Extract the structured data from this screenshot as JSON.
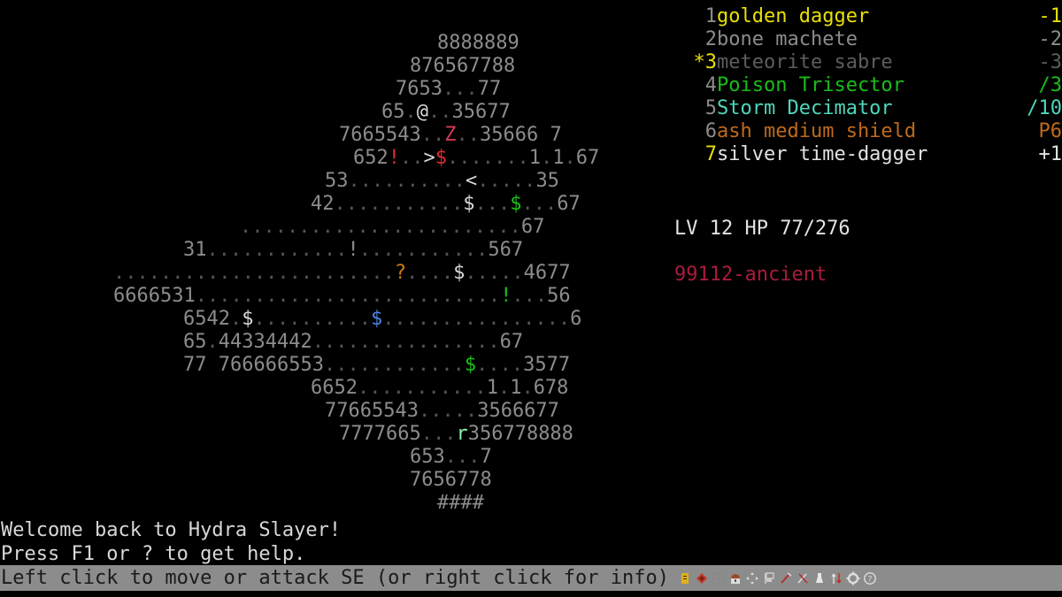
{
  "app": {
    "title": "Hydra Slayer",
    "background": "#000000"
  },
  "colors": {
    "wall": "#8c8c8c",
    "floor": "#555555",
    "player": "#d8d8d8",
    "enemy_z": "#d33a54",
    "gold": "#e8e005",
    "green": "#17c217",
    "blue": "#4d84e8",
    "orange": "#d07a16",
    "red": "#e02d2d",
    "hintbar_bg": "#8c8c8c",
    "seed": "#a81c3c"
  },
  "map": {
    "legend": {
      "@": "player",
      "Z": "hydra-enemy",
      "r": "rat-enemy",
      "$": "treasure",
      "!": "potion",
      "?": "scroll",
      ">": "stairs-down",
      "<": "stairs-up",
      "#": "wall-block",
      ".": "floor",
      "digits": "wall-thickness"
    },
    "rows": [
      {
        "indent": 31,
        "cells": [
          [
            "8888889",
            "wall"
          ]
        ]
      },
      {
        "indent": 29,
        "cells": [
          [
            "876567788",
            "wall"
          ]
        ]
      },
      {
        "indent": 28,
        "cells": [
          [
            "7653",
            "wall"
          ],
          [
            "...",
            "floor"
          ],
          [
            "77",
            "wall"
          ]
        ]
      },
      {
        "indent": 27,
        "cells": [
          [
            "65",
            "wall"
          ],
          [
            ".",
            "floor"
          ],
          [
            "@",
            "white"
          ],
          [
            "..",
            "floor"
          ],
          [
            "35677",
            "wall"
          ]
        ]
      },
      {
        "indent": 24,
        "cells": [
          [
            "7665543",
            "wall"
          ],
          [
            "..",
            "floor"
          ],
          [
            "Z",
            "crimson"
          ],
          [
            "..",
            "floor"
          ],
          [
            "35666 7",
            "wall"
          ]
        ]
      },
      {
        "indent": 25,
        "cells": [
          [
            "652",
            "wall"
          ],
          [
            "!",
            "red"
          ],
          [
            "..",
            "floor"
          ],
          [
            ">",
            "white"
          ],
          [
            "$",
            "red"
          ],
          [
            ".......",
            "floor"
          ],
          [
            "1",
            "wall"
          ],
          [
            ".",
            "floor"
          ],
          [
            "1",
            "wall"
          ],
          [
            ".",
            "floor"
          ],
          [
            "67",
            "wall"
          ]
        ]
      },
      {
        "indent": 23,
        "cells": [
          [
            "53",
            "wall"
          ],
          [
            "..........",
            "floor"
          ],
          [
            "<",
            "white"
          ],
          [
            ".....",
            "floor"
          ],
          [
            "35",
            "wall"
          ]
        ]
      },
      {
        "indent": 22,
        "cells": [
          [
            "42",
            "wall"
          ],
          [
            "...........",
            "floor"
          ],
          [
            "$",
            "white"
          ],
          [
            "...",
            "floor"
          ],
          [
            "$",
            "green"
          ],
          [
            "...",
            "floor"
          ],
          [
            "67",
            "wall"
          ]
        ]
      },
      {
        "indent": 17,
        "cells": [
          [
            "........................",
            "floor"
          ],
          [
            "67",
            "wall"
          ]
        ]
      },
      {
        "indent": 13,
        "cells": [
          [
            "31",
            "wall"
          ],
          [
            "............",
            "floor"
          ],
          [
            "!",
            "grey"
          ],
          [
            "...........",
            "floor"
          ],
          [
            "567",
            "wall"
          ]
        ]
      },
      {
        "indent": 8,
        "cells": [
          [
            "........................",
            "floor"
          ],
          [
            "?",
            "orange"
          ],
          [
            "....",
            "floor"
          ],
          [
            "$",
            "white"
          ],
          [
            ".....",
            "floor"
          ],
          [
            "4677",
            "wall"
          ]
        ]
      },
      {
        "indent": 8,
        "cells": [
          [
            "6666531",
            "wall"
          ],
          [
            "..........................",
            "floor"
          ],
          [
            "!",
            "green"
          ],
          [
            "...",
            "floor"
          ],
          [
            "56",
            "wall"
          ]
        ]
      },
      {
        "indent": 13,
        "cells": [
          [
            "6542",
            "wall"
          ],
          [
            ".",
            "floor"
          ],
          [
            "$",
            "white"
          ],
          [
            "..........",
            "floor"
          ],
          [
            "$",
            "blue"
          ],
          [
            "................",
            "floor"
          ],
          [
            "6",
            "wall"
          ]
        ]
      },
      {
        "indent": 13,
        "cells": [
          [
            "65",
            "wall"
          ],
          [
            ".",
            "floor"
          ],
          [
            "44334442",
            "wall"
          ],
          [
            "................",
            "floor"
          ],
          [
            "67",
            "wall"
          ]
        ]
      },
      {
        "indent": 13,
        "cells": [
          [
            "77 766666553",
            "wall"
          ],
          [
            "............",
            "floor"
          ],
          [
            "$",
            "green"
          ],
          [
            "....",
            "floor"
          ],
          [
            "3577",
            "wall"
          ]
        ]
      },
      {
        "indent": 22,
        "cells": [
          [
            "6652",
            "wall"
          ],
          [
            "...........",
            "floor"
          ],
          [
            "1",
            "wall"
          ],
          [
            ".",
            "floor"
          ],
          [
            "1",
            "wall"
          ],
          [
            ".",
            "floor"
          ],
          [
            "678",
            "wall"
          ]
        ]
      },
      {
        "indent": 23,
        "cells": [
          [
            "77665543",
            "wall"
          ],
          [
            ".....",
            "floor"
          ],
          [
            "3566677",
            "wall"
          ]
        ]
      },
      {
        "indent": 24,
        "cells": [
          [
            "7777665",
            "wall"
          ],
          [
            "...",
            "floor"
          ],
          [
            "r",
            "ltgreen"
          ],
          [
            "356778888",
            "wall"
          ]
        ]
      },
      {
        "indent": 29,
        "cells": [
          [
            "653",
            "wall"
          ],
          [
            "...",
            "floor"
          ],
          [
            "7",
            "wall"
          ]
        ]
      },
      {
        "indent": 29,
        "cells": [
          [
            "7656778",
            "wall"
          ]
        ]
      },
      {
        "indent": 31,
        "cells": [
          [
            "####",
            "wall"
          ]
        ]
      }
    ]
  },
  "inventory": {
    "items": [
      {
        "index": "1",
        "selected": false,
        "name": "golden dagger",
        "value": "-1",
        "color": "yellow",
        "index_color": "grey"
      },
      {
        "index": "2",
        "selected": false,
        "name": "bone machete",
        "value": "-2",
        "color": "grey",
        "index_color": "grey"
      },
      {
        "index": "3",
        "selected": true,
        "name": "meteorite sabre",
        "value": "-3",
        "color": "dim",
        "index_color": "yellow"
      },
      {
        "index": "4",
        "selected": false,
        "name": "Poison Trisector",
        "value": "/3",
        "color": "green",
        "index_color": "grey"
      },
      {
        "index": "5",
        "selected": false,
        "name": "Storm Decimator",
        "value": "/10",
        "color": "teal",
        "index_color": "grey"
      },
      {
        "index": "6",
        "selected": false,
        "name": "ash medium shield",
        "value": "P6",
        "color": "brown",
        "index_color": "grey"
      },
      {
        "index": "7",
        "selected": false,
        "name": "silver time-dagger",
        "value": "+1",
        "color": "white",
        "index_color": "yellow"
      }
    ],
    "selection_marker": "*"
  },
  "stats": {
    "line": "LV 12 HP 77/276",
    "level_label": "LV",
    "level": "12",
    "hp_label": "HP",
    "hp_current": "77",
    "hp_max": "276"
  },
  "seed": {
    "text": "99112-ancient"
  },
  "messages": [
    "Welcome back to Hydra Slayer!",
    "Press F1 or ? to get help."
  ],
  "hintbar": {
    "text": "Left click to move or attack SE (or right click for info)",
    "icons": [
      {
        "name": "scroll-icon",
        "color": "#e0b21a"
      },
      {
        "name": "gem-icon",
        "color": "#c0392b"
      },
      {
        "name": "grid-map-icon",
        "color": "#888888"
      },
      {
        "name": "chest-icon",
        "color": "#9a4a2a"
      },
      {
        "name": "move-arrows-icon",
        "color": "#dddddd"
      },
      {
        "name": "flag-icon",
        "color": "#cccccc"
      },
      {
        "name": "sword-red-icon",
        "color": "#b03030"
      },
      {
        "name": "sword-pair-icon",
        "color": "#b03030"
      },
      {
        "name": "potion-icon",
        "color": "#e8e8e8"
      },
      {
        "name": "arrows-updown-icon",
        "color": "#c03020"
      },
      {
        "name": "gear-icon",
        "color": "#dddddd"
      },
      {
        "name": "help-icon",
        "color": "#dddddd"
      }
    ]
  }
}
